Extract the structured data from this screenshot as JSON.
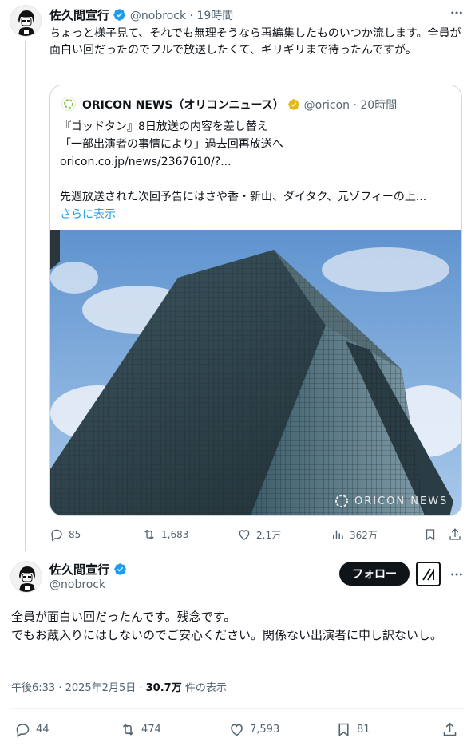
{
  "reply_tweet": {
    "display_name": "佐久間宣行",
    "handle": "@nobrock",
    "dot": "·",
    "time": "19時間",
    "text": "ちょっと様子見て、それでも無理そうなら再編集したものいつか流します。全員が面白い回だったのでフルで放送したくて、ギリギリまで待ったんですが。",
    "quote": {
      "source_name": "ORICON NEWS（オリコンニュース）",
      "source_handle": "@oricon",
      "dot": "·",
      "time": "20時間",
      "line1": "『ゴッドタン』8日放送の内容を差し替え",
      "line2": "「一部出演者の事情により」過去回再放送へ",
      "url": "oricon.co.jp/news/2367610/?...",
      "line3": "先週放送された次回予告にはさや香・新山、ダイタク、元ゾフィーの上...",
      "show_more": "さらに表示",
      "watermark": "ORICON NEWS"
    },
    "actions": {
      "replies": "85",
      "retweets": "1,683",
      "likes": "2.1万",
      "views": "362万"
    }
  },
  "main_tweet": {
    "display_name": "佐久間宣行",
    "handle": "@nobrock",
    "follow_label": "フォロー",
    "text_line1": "全員が面白い回だったんです。残念です。",
    "text_line2": "でもお蔵入りにはしないのでご安心ください。関係ない出演者に申し訳ないし。",
    "timestamp": "午後6:33 · 2025年2月5日 · ",
    "views_count": "30.7万",
    "views_label": " 件の表示",
    "actions": {
      "replies": "44",
      "retweets": "474",
      "likes": "7,593",
      "bookmarks": "81"
    }
  },
  "colors": {
    "accent": "#1d9bf0",
    "text": "#0f1419",
    "muted": "#536471",
    "verified": "#1d9bf0",
    "gold": "#e2b719"
  }
}
